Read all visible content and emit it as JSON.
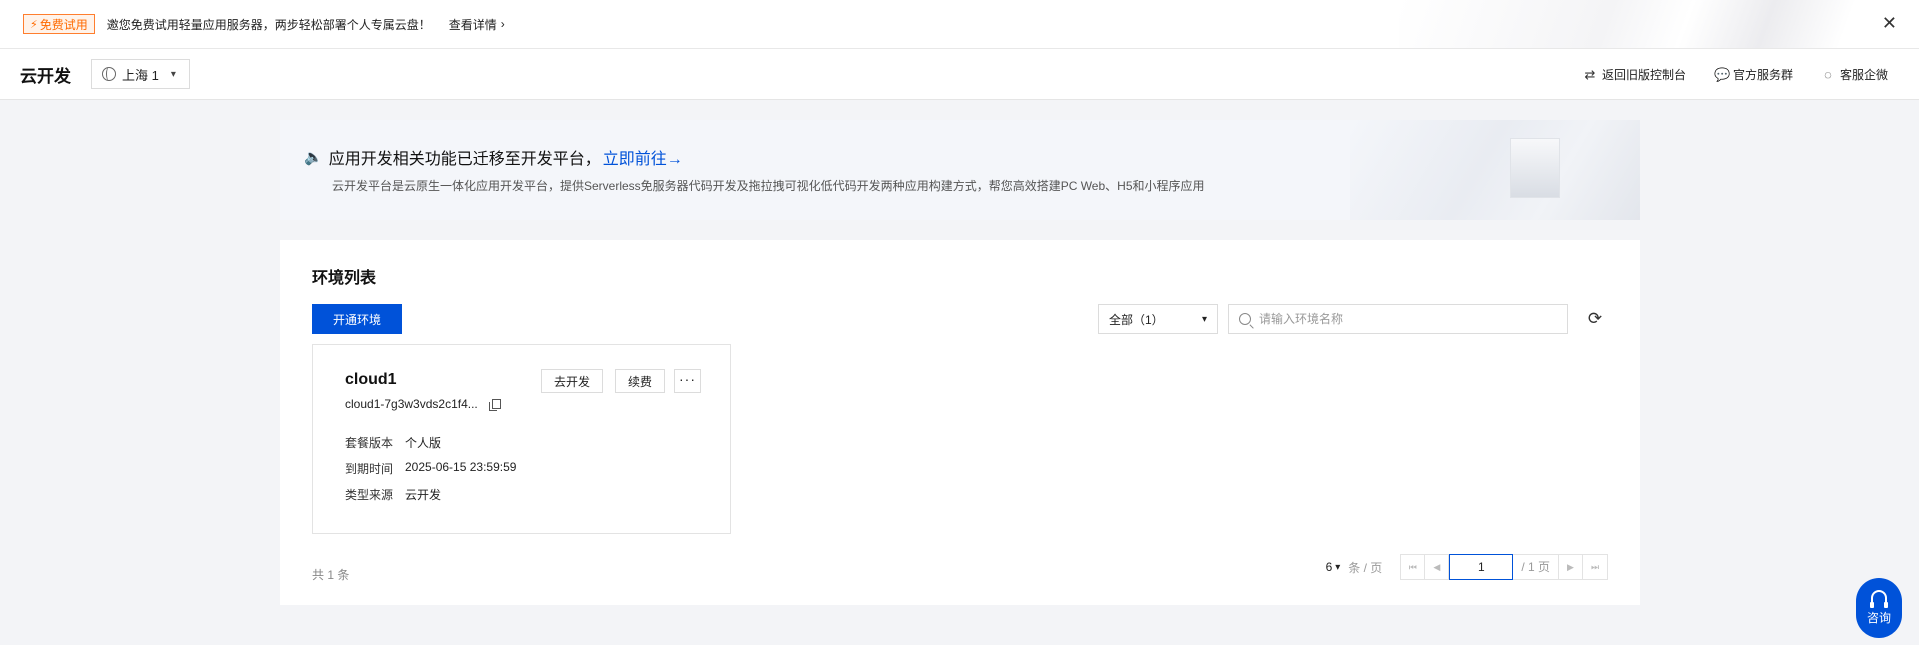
{
  "promo": {
    "badge": "免费试用",
    "text": "邀您免费试用轻量应用服务器，两步轻松部署个人专属云盘！",
    "link": "查看详情"
  },
  "header": {
    "title": "云开发",
    "region": "上海 1",
    "links": [
      "返回旧版控制台",
      "官方服务群",
      "客服企微"
    ]
  },
  "notice": {
    "title": "应用开发相关功能已迁移至开发平台，",
    "link": "立即前往→",
    "description": "云开发平台是云原生一体化应用开发平台，提供Serverless免服务器代码开发及拖拉拽可视化低代码开发两种应用构建方式，帮您高效搭建PC Web、H5和小程序应用"
  },
  "env_list": {
    "title": "环境列表",
    "create_button": "开通环境",
    "filter": "全部（1）",
    "search_placeholder": "请输入环境名称",
    "card": {
      "name": "cloud1",
      "id": "cloud1-7g3w3vds2c1f4...",
      "buttons": {
        "dev": "去开发",
        "renew": "续费",
        "more": "···"
      },
      "rows": [
        {
          "key": "套餐版本",
          "value": "个人版"
        },
        {
          "key": "到期时间",
          "value": "2025-06-15 23:59:59"
        },
        {
          "key": "类型来源",
          "value": "云开发"
        }
      ]
    },
    "total": "共 1 条",
    "pagination": {
      "page_size": "6",
      "per_page_label": "条 / 页",
      "current_page": "1",
      "total_pages": "/ 1 页"
    }
  },
  "consult": {
    "label": "咨询"
  },
  "colors": {
    "primary": "#0052d9",
    "promo_orange": "#ff6a00",
    "background": "#f3f4f7"
  }
}
